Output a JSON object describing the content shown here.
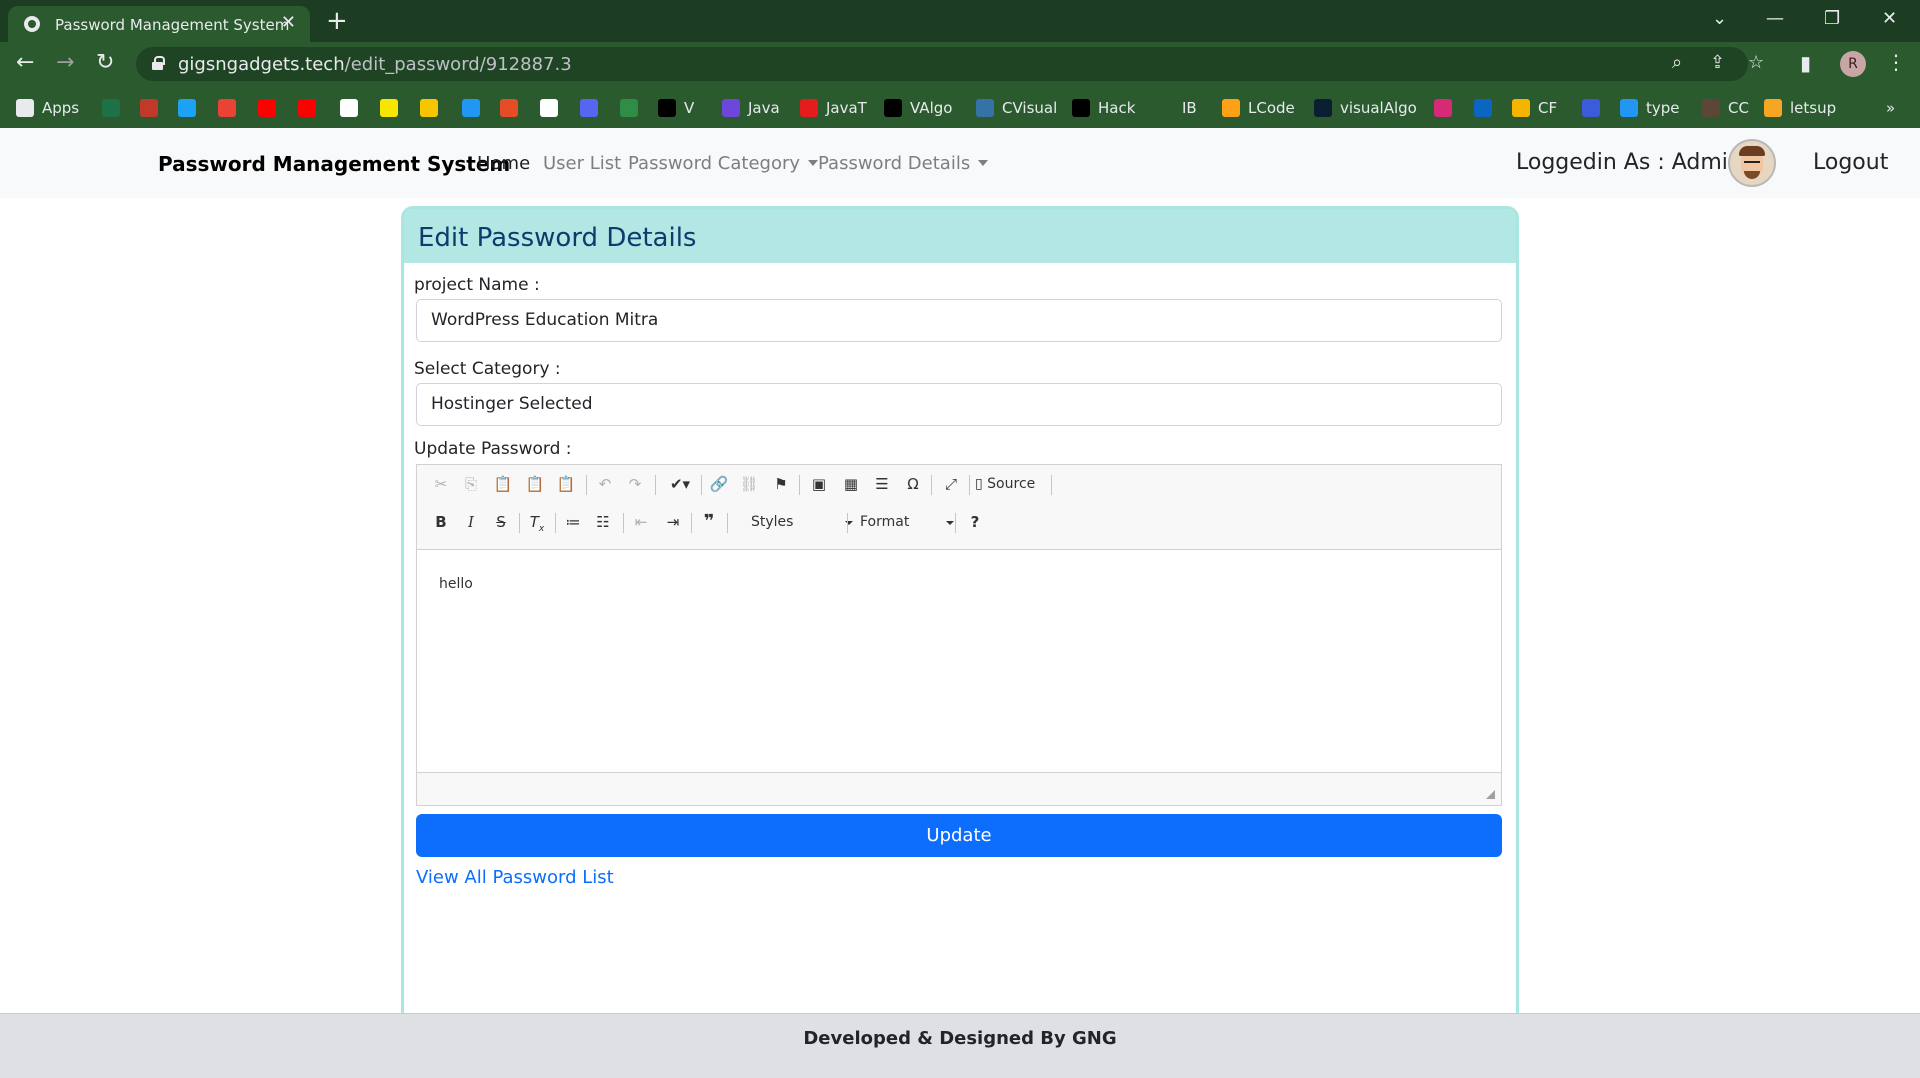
{
  "browser": {
    "tab_title": "Password Management System",
    "url_host": "gigsngadgets.tech",
    "url_path": "/edit_password/912887.3",
    "profile_initial": "R",
    "bookmarks": [
      {
        "label": "Apps",
        "icon": "apps-grid-icon",
        "color": "#e8eaed"
      },
      {
        "label": "",
        "icon": "excel-icon",
        "color": "#1e7145"
      },
      {
        "label": "",
        "icon": "speed-icon",
        "color": "#c0392b"
      },
      {
        "label": "",
        "icon": "p-icon",
        "color": "#1da1f2"
      },
      {
        "label": "",
        "icon": "gmail-icon",
        "color": "#ea4335"
      },
      {
        "label": "",
        "icon": "youtube-icon",
        "color": "#ff0000"
      },
      {
        "label": "",
        "icon": "youtube-music-icon",
        "color": "#ff0000"
      },
      {
        "label": "",
        "icon": "amazon-icon",
        "color": "#ffffff"
      },
      {
        "label": "",
        "icon": "flipkart-icon",
        "color": "#f7e600"
      },
      {
        "label": "",
        "icon": "pinterest-p-icon",
        "color": "#f7c600"
      },
      {
        "label": "",
        "icon": "arrow-icon",
        "color": "#2196f3"
      },
      {
        "label": "",
        "icon": "code-icon",
        "color": "#e44d26"
      },
      {
        "label": "",
        "icon": "github-icon",
        "color": "#ffffff"
      },
      {
        "label": "",
        "icon": "discord-icon",
        "color": "#5865f2"
      },
      {
        "label": "",
        "icon": "gfg-icon",
        "color": "#2f8d46"
      },
      {
        "label": "V",
        "icon": "v-icon",
        "color": "#000000"
      },
      {
        "label": "Java",
        "icon": "java-bolt-icon",
        "color": "#6c47d9"
      },
      {
        "label": "JavaT",
        "icon": "javat-icon",
        "color": "#e41c1c"
      },
      {
        "label": "VAlgo",
        "icon": "valgo-icon",
        "color": "#000000"
      },
      {
        "label": "CVisual",
        "icon": "python-icon",
        "color": "#3572a5"
      },
      {
        "label": "Hack",
        "icon": "hackerrank-icon",
        "color": "#000000"
      },
      {
        "label": "IB",
        "icon": "ib-icon",
        "color": "#2b5a2f"
      },
      {
        "label": "LCode",
        "icon": "leetcode-icon",
        "color": "#ffa116"
      },
      {
        "label": "visualAlgo",
        "icon": "visualalgo-icon",
        "color": "#0b1f33"
      },
      {
        "label": "",
        "icon": "instagram-icon",
        "color": "#d62976"
      },
      {
        "label": "",
        "icon": "linkedin-icon",
        "color": "#0a66c2"
      },
      {
        "label": "CF",
        "icon": "codeforces-icon",
        "color": "#f4b400"
      },
      {
        "label": "",
        "icon": "link-icon",
        "color": "#3b5bdb"
      },
      {
        "label": "type",
        "icon": "typeracer-icon",
        "color": "#2196f3"
      },
      {
        "label": "CC",
        "icon": "codechef-icon",
        "color": "#5b4638"
      },
      {
        "label": "letsup",
        "icon": "letsup-icon",
        "color": "#f5a623"
      }
    ],
    "more_bookmarks": "»"
  },
  "site_nav": {
    "brand": "Password Management System",
    "links": [
      "Home",
      "User List",
      "Password Category",
      "Password Details"
    ],
    "logged_in_text": "Loggedin As : Admin",
    "logout": "Logout"
  },
  "card": {
    "title": "Edit Password Details",
    "project_label": "project Name :",
    "project_value": "WordPress Education Mitra",
    "category_label": "Select Category :",
    "category_value": "Hostinger Selected",
    "password_label": "Update Password :",
    "editor": {
      "source_label": "Source",
      "styles_label": "Styles",
      "format_label": "Format",
      "content": "hello"
    },
    "update_button": "Update",
    "view_all_link": "View All Password List"
  },
  "footer": {
    "text": "Developed & Designed By GNG"
  },
  "colors": {
    "browser_frame": "#2b5a2f",
    "card_header": "#b3e7e3",
    "primary": "#0d6efd",
    "title": "#0a3c6e"
  }
}
